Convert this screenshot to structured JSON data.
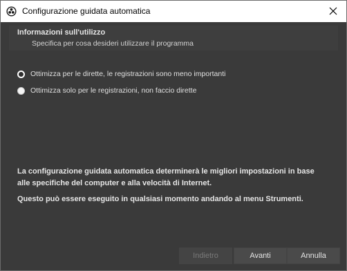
{
  "window": {
    "title": "Configurazione guidata automatica",
    "app_icon": "obs-logo-icon",
    "close_icon": "close-icon"
  },
  "page": {
    "heading": "Informazioni sull'utilizzo",
    "subheading": "Specifica per cosa desideri utilizzare il programma"
  },
  "options": [
    {
      "label": "Ottimizza per le dirette, le registrazioni sono meno importanti",
      "selected": true
    },
    {
      "label": "Ottimizza solo per le registrazioni, non faccio dirette",
      "selected": false
    }
  ],
  "info": {
    "line1": "La configurazione guidata automatica determinerà le migliori impostazioni in base alle specifiche del computer e alla velocità di Internet.",
    "line2": "Questo può essere eseguito in qualsiasi momento andando al menu Strumenti."
  },
  "buttons": {
    "back": "Indietro",
    "next": "Avanti",
    "cancel": "Annulla",
    "back_enabled": false
  },
  "colors": {
    "background": "#3a3a3a",
    "titlebar": "#ffffff",
    "button": "#4a4a4a"
  }
}
